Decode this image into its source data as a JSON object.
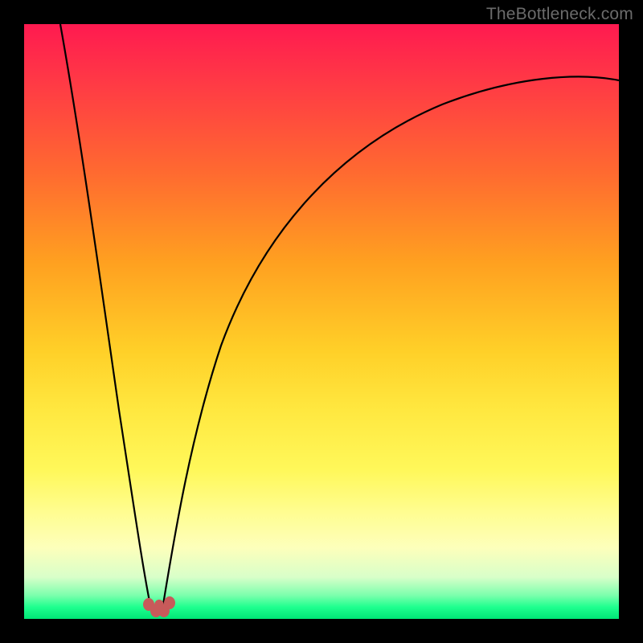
{
  "watermark": {
    "text": "TheBottleneck.com"
  },
  "chart_data": {
    "type": "line",
    "title": "",
    "xlabel": "",
    "ylabel": "",
    "xlim": [
      0,
      100
    ],
    "ylim": [
      0,
      100
    ],
    "curve_left": {
      "x": [
        6,
        8,
        10,
        12,
        14,
        16,
        18,
        19.5,
        20.5,
        21
      ],
      "y": [
        100,
        85,
        70,
        55,
        40,
        25,
        12,
        5,
        2,
        0
      ]
    },
    "curve_right": {
      "x": [
        23,
        24,
        26,
        30,
        35,
        42,
        50,
        60,
        72,
        85,
        100
      ],
      "y": [
        0,
        2,
        10,
        28,
        45,
        60,
        70,
        78,
        84,
        88,
        90
      ]
    },
    "marker_cluster": {
      "x_center": 22,
      "y_center": 2,
      "count": 5
    }
  }
}
